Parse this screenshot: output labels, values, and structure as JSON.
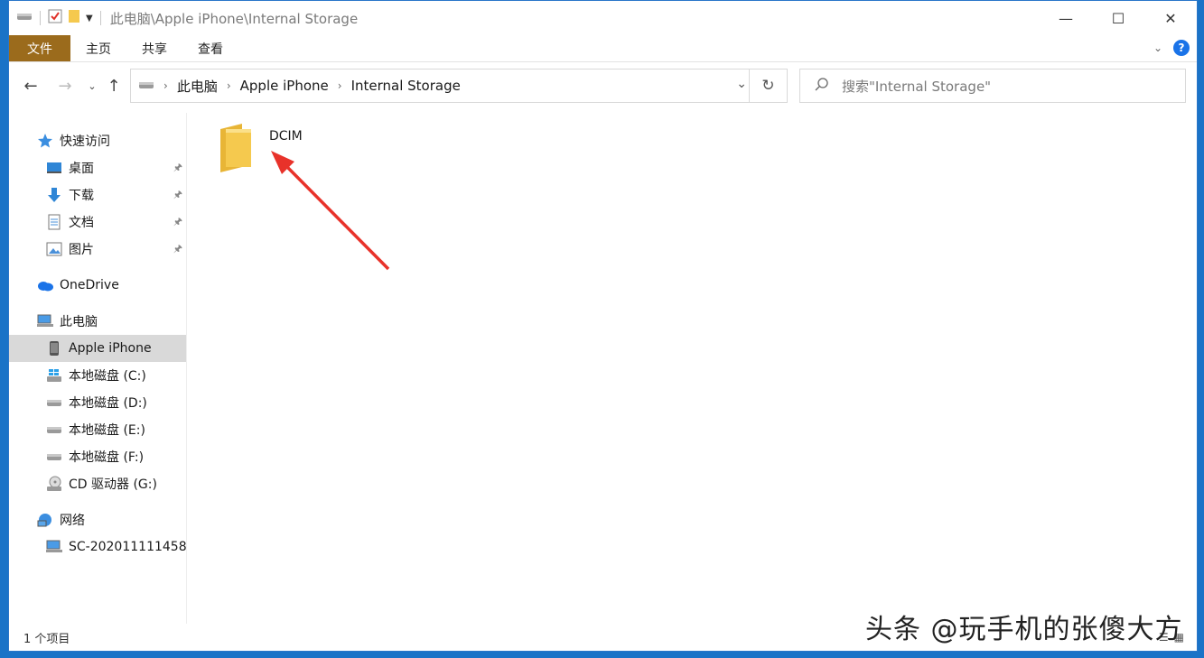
{
  "window": {
    "title": "此电脑\\Apple iPhone\\Internal Storage"
  },
  "ribbon": {
    "tabs": [
      "文件",
      "主页",
      "共享",
      "查看"
    ],
    "help_label": "?"
  },
  "navigation": {
    "breadcrumb": [
      "此电脑",
      "Apple iPhone",
      "Internal Storage"
    ],
    "search_placeholder": "搜索\"Internal Storage\""
  },
  "sidebar": {
    "quick_access": "快速访问",
    "quick_items": [
      "桌面",
      "下载",
      "文档",
      "图片"
    ],
    "onedrive": "OneDrive",
    "this_pc": "此电脑",
    "pc_items": [
      "Apple iPhone",
      "本地磁盘 (C:)",
      "本地磁盘 (D:)",
      "本地磁盘 (E:)",
      "本地磁盘 (F:)",
      "CD 驱动器 (G:)"
    ],
    "network": "网络",
    "network_items": [
      "SC-202011111458"
    ]
  },
  "content": {
    "items": [
      {
        "name": "DCIM"
      }
    ]
  },
  "status": {
    "count": "1 个项目"
  },
  "watermark": "头条 @玩手机的张傻大方",
  "colors": {
    "file_tab": "#9b6b1c",
    "accent": "#1a73e8",
    "arrow": "#e8322a",
    "folder": "#f5c94e"
  }
}
